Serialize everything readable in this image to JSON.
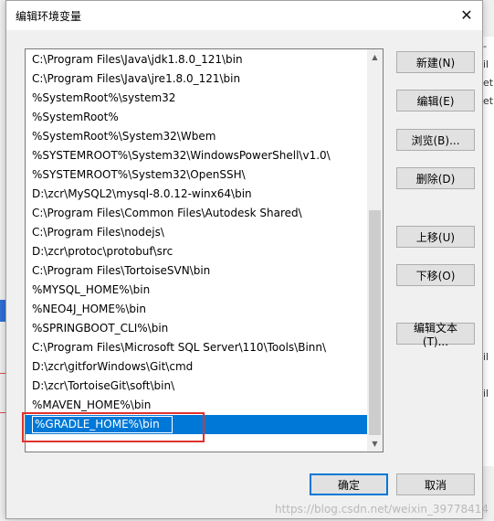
{
  "dialog": {
    "title": "编辑环境变量",
    "close_glyph": "✕"
  },
  "path_entries": [
    "C:\\Program Files\\Java\\jdk1.8.0_121\\bin",
    "C:\\Program Files\\Java\\jre1.8.0_121\\bin",
    "%SystemRoot%\\system32",
    "%SystemRoot%",
    "%SystemRoot%\\System32\\Wbem",
    "%SYSTEMROOT%\\System32\\WindowsPowerShell\\v1.0\\",
    "%SYSTEMROOT%\\System32\\OpenSSH\\",
    "D:\\zcr\\MySQL2\\mysql-8.0.12-winx64\\bin",
    "C:\\Program Files\\Common Files\\Autodesk Shared\\",
    "C:\\Program Files\\nodejs\\",
    "D:\\zcr\\protoc\\protobuf\\src",
    "C:\\Program Files\\TortoiseSVN\\bin",
    "%MYSQL_HOME%\\bin",
    "%NEO4J_HOME%\\bin",
    "%SPRINGBOOT_CLI%\\bin",
    "C:\\Program Files\\Microsoft SQL Server\\110\\Tools\\Binn\\",
    "D:\\zcr\\gitforWindows\\Git\\cmd",
    "D:\\zcr\\TortoiseGit\\soft\\bin\\",
    "%MAVEN_HOME%\\bin"
  ],
  "editing_entry": {
    "value": "%GRADLE_HOME%\\bin"
  },
  "buttons": {
    "new": "新建(N)",
    "edit": "编辑(E)",
    "browse": "浏览(B)...",
    "delete": "删除(D)",
    "move_up": "上移(U)",
    "move_down": "下移(O)",
    "edit_text": "编辑文本(T)...",
    "ok": "确定",
    "cancel": "取消"
  },
  "scrollbar": {
    "up_glyph": "▲",
    "down_glyph": "▼"
  },
  "background_fragments": [
    "-",
    "il",
    "et",
    "et",
    "il",
    "il"
  ],
  "watermark": "https://blog.csdn.net/weixin_39778414",
  "colors": {
    "selection": "#0078d7",
    "highlight_box": "#e0322d"
  }
}
